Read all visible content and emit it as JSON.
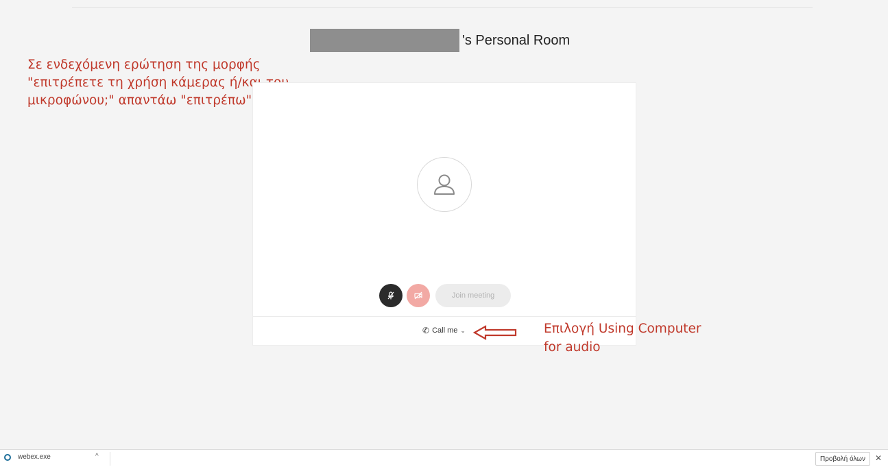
{
  "header": {
    "room_title": "'s Personal Room"
  },
  "annotations": {
    "permission_note": "Σε ενδεχόμενη ερώτηση της μορφής \"επιτρέπετε τη χρήση κάμερας ή/και του μικροφώνου;\" απαντάω \"επιτρέπω\"",
    "audio_note": "Επιλογή Using Computer for audio",
    "note_color": "#c0392b"
  },
  "preview": {
    "avatar_icon": "user-icon",
    "join_label": "Join meeting",
    "audio_option_label": "Call me",
    "audio_option_icon": "phone-icon",
    "mute_color": "#2b2b2b",
    "video_off_color": "#f2a9a4"
  },
  "download_bar": {
    "file_name": "webex.exe",
    "show_all_label": "Προβολή όλων",
    "file_icon": "webex-icon"
  }
}
